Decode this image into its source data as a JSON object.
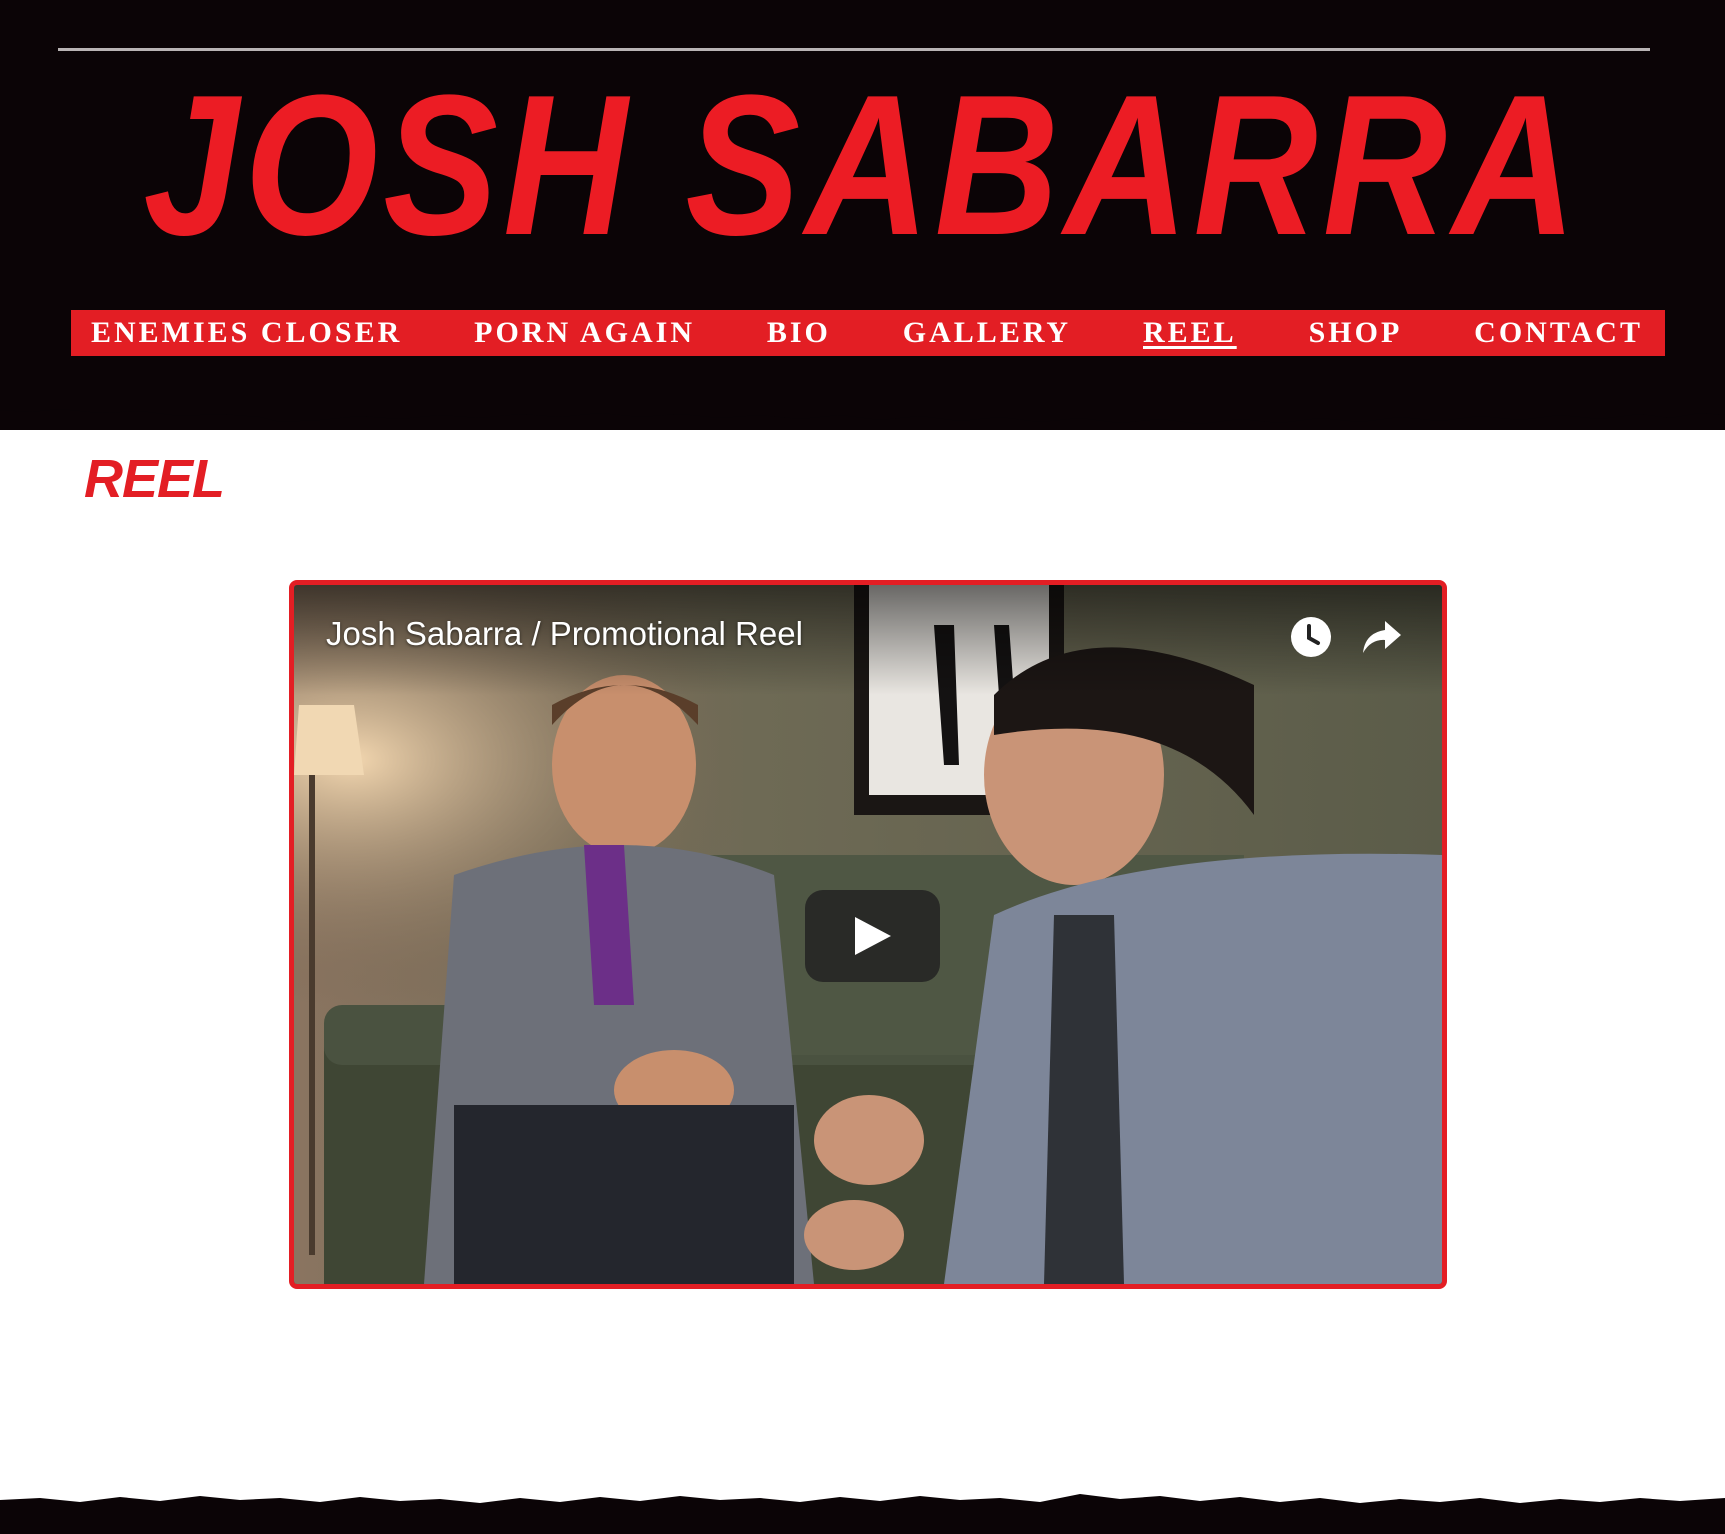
{
  "site": {
    "title": "JOSH SABARRA"
  },
  "nav": {
    "items": [
      {
        "label": "ENEMIES CLOSER"
      },
      {
        "label": "PORN AGAIN"
      },
      {
        "label": "BIO"
      },
      {
        "label": "GALLERY"
      },
      {
        "label": "REEL",
        "active": true
      },
      {
        "label": "SHOP"
      },
      {
        "label": "CONTACT"
      }
    ]
  },
  "page": {
    "heading": "REEL"
  },
  "video": {
    "title": "Josh Sabarra / Promotional Reel",
    "watch_later_icon": "clock-icon",
    "share_icon": "share-arrow-icon",
    "play_icon": "play-icon"
  },
  "colors": {
    "accent": "#e31e24",
    "header_bg": "#0b0406",
    "page_bg": "#ffffff"
  }
}
